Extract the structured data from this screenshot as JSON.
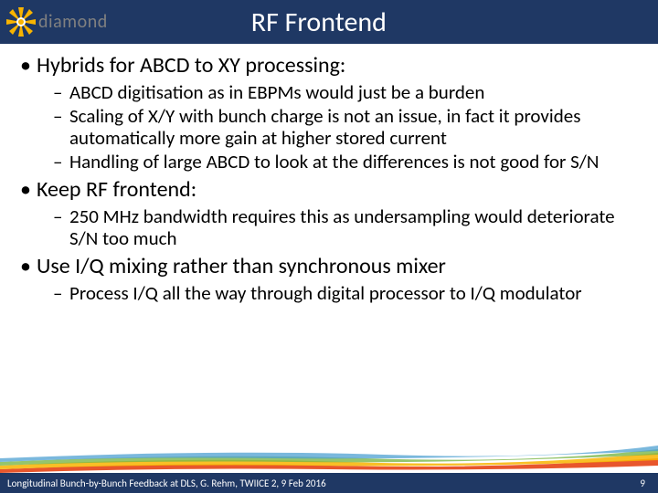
{
  "logo": {
    "text": "diamond"
  },
  "title": "RF Frontend",
  "bullets": [
    {
      "text": "Hybrids for ABCD to XY processing:",
      "subs": [
        "ABCD digitisation as in EBPMs would just be a burden",
        "Scaling of X/Y with bunch charge is not an issue, in fact it provides automatically more gain at higher stored current",
        "Handling of large ABCD to look at the differences is not good for S/N"
      ]
    },
    {
      "text": "Keep RF frontend:",
      "subs": [
        "250 MHz bandwidth requires this as undersampling would deteriorate S/N too much"
      ]
    },
    {
      "text": "Use I/Q mixing rather than synchronous mixer",
      "subs": [
        "Process I/Q all the way through digital processor to I/Q modulator"
      ]
    }
  ],
  "footer": {
    "left": "Longitudinal Bunch-by-Bunch Feedback at DLS, G. Rehm, TWIICE 2, 9 Feb 2016",
    "right": "9"
  },
  "colors": {
    "bar": "#1f3864",
    "stripe1": "#e64415",
    "stripe2": "#f8b400",
    "stripe3": "#7ab648",
    "stripe4": "#4ea0d1"
  }
}
